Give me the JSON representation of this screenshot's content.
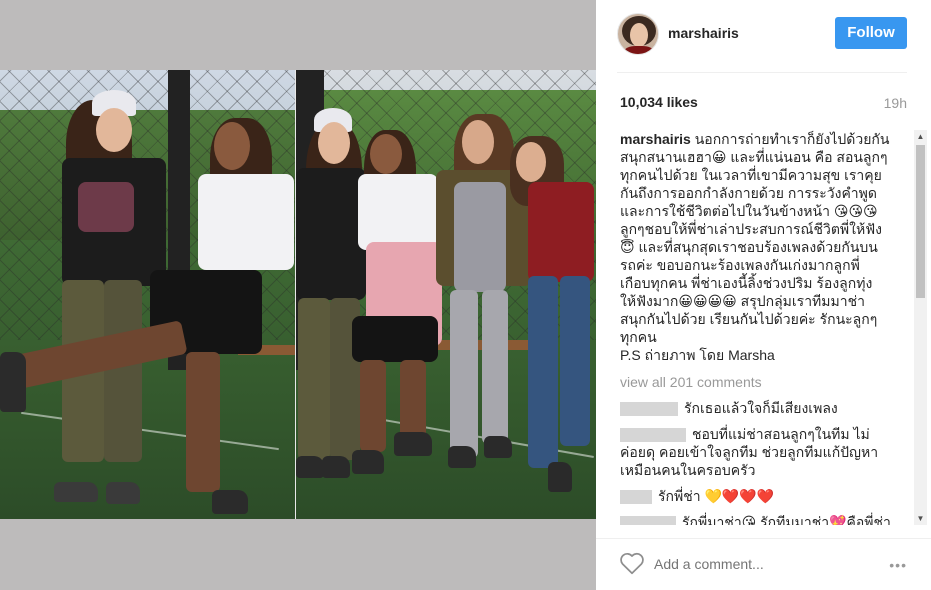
{
  "header": {
    "username": "marshairis",
    "follow_label": "Follow"
  },
  "stats": {
    "likes": "10,034 likes",
    "time_ago": "19h"
  },
  "caption": {
    "username": "marshairis",
    "lines": [
      "นอกการถ่ายทำเราก็ยังไปด้วยกัน",
      "สนุกสนานเฮฮา😀 และที่แน่นอน คือ สอนลูกๆ",
      "ทุกคนไปด้วย ในเวลาที่เขามีความสุข เราคุย",
      "กันถึงการออกกำลังกายด้วย การระวังคำพูด",
      "และการใช้ชีวิตต่อไปในวันข้างหน้า 😘😘😘",
      "ลูกๆชอบให้พี่ช่าเล่าประสบการณ์ชีวิตพี่ให้ฟัง",
      "😇 และที่สนุกสุดเราชอบร้องเพลงด้วยกันบน",
      "รถค่ะ ขอบอกนะร้องเพลงกันเก่งมากลูกพี่",
      "เกือบทุกคน พี่ช่าเองนี้ลิ้งช่วงปริม ร้องลูกทุ่ง",
      "ให้ฟังมาก😀😀😀😀 สรุปกลุ่มเราทีมมาช่า",
      "สนุกกันไปด้วย เรียนกันไปด้วยค่ะ รักนะลูกๆ",
      "ทุกคน"
    ],
    "ps": "P.S ถ่ายภาพ โดย Marsha"
  },
  "view_all_label": "view all 201 comments",
  "comments": [
    {
      "lines": [
        "รักเธอแล้วใจก็มีเสียงเพลง"
      ]
    },
    {
      "lines": [
        "ชอบที่แม่ช่าสอนลูกๆในทีม ไม่",
        "ค่อยดุ คอยเข้าใจลูกทีม ช่วยลูกทีมแก้ปัญหา",
        "เหมือนคนในครอบครัว"
      ]
    },
    {
      "lines": [
        "รักพี่ช่า"
      ],
      "hearts": [
        "💛",
        "❤️",
        "❤️",
        "❤️"
      ]
    },
    {
      "lines": [
        "รักพี่มาช่า😘 รักทีมมาช่า💖คือพี่ช่า"
      ]
    }
  ],
  "footer": {
    "add_comment_placeholder": "Add a comment...",
    "more_label": "•••"
  },
  "colors": {
    "follow_bg": "#3897f0",
    "muted": "#999999",
    "text": "#262626",
    "media_bg": "#bdbbbb"
  },
  "icons": {
    "like": "heart-outline-icon",
    "more": "more-options-icon"
  }
}
